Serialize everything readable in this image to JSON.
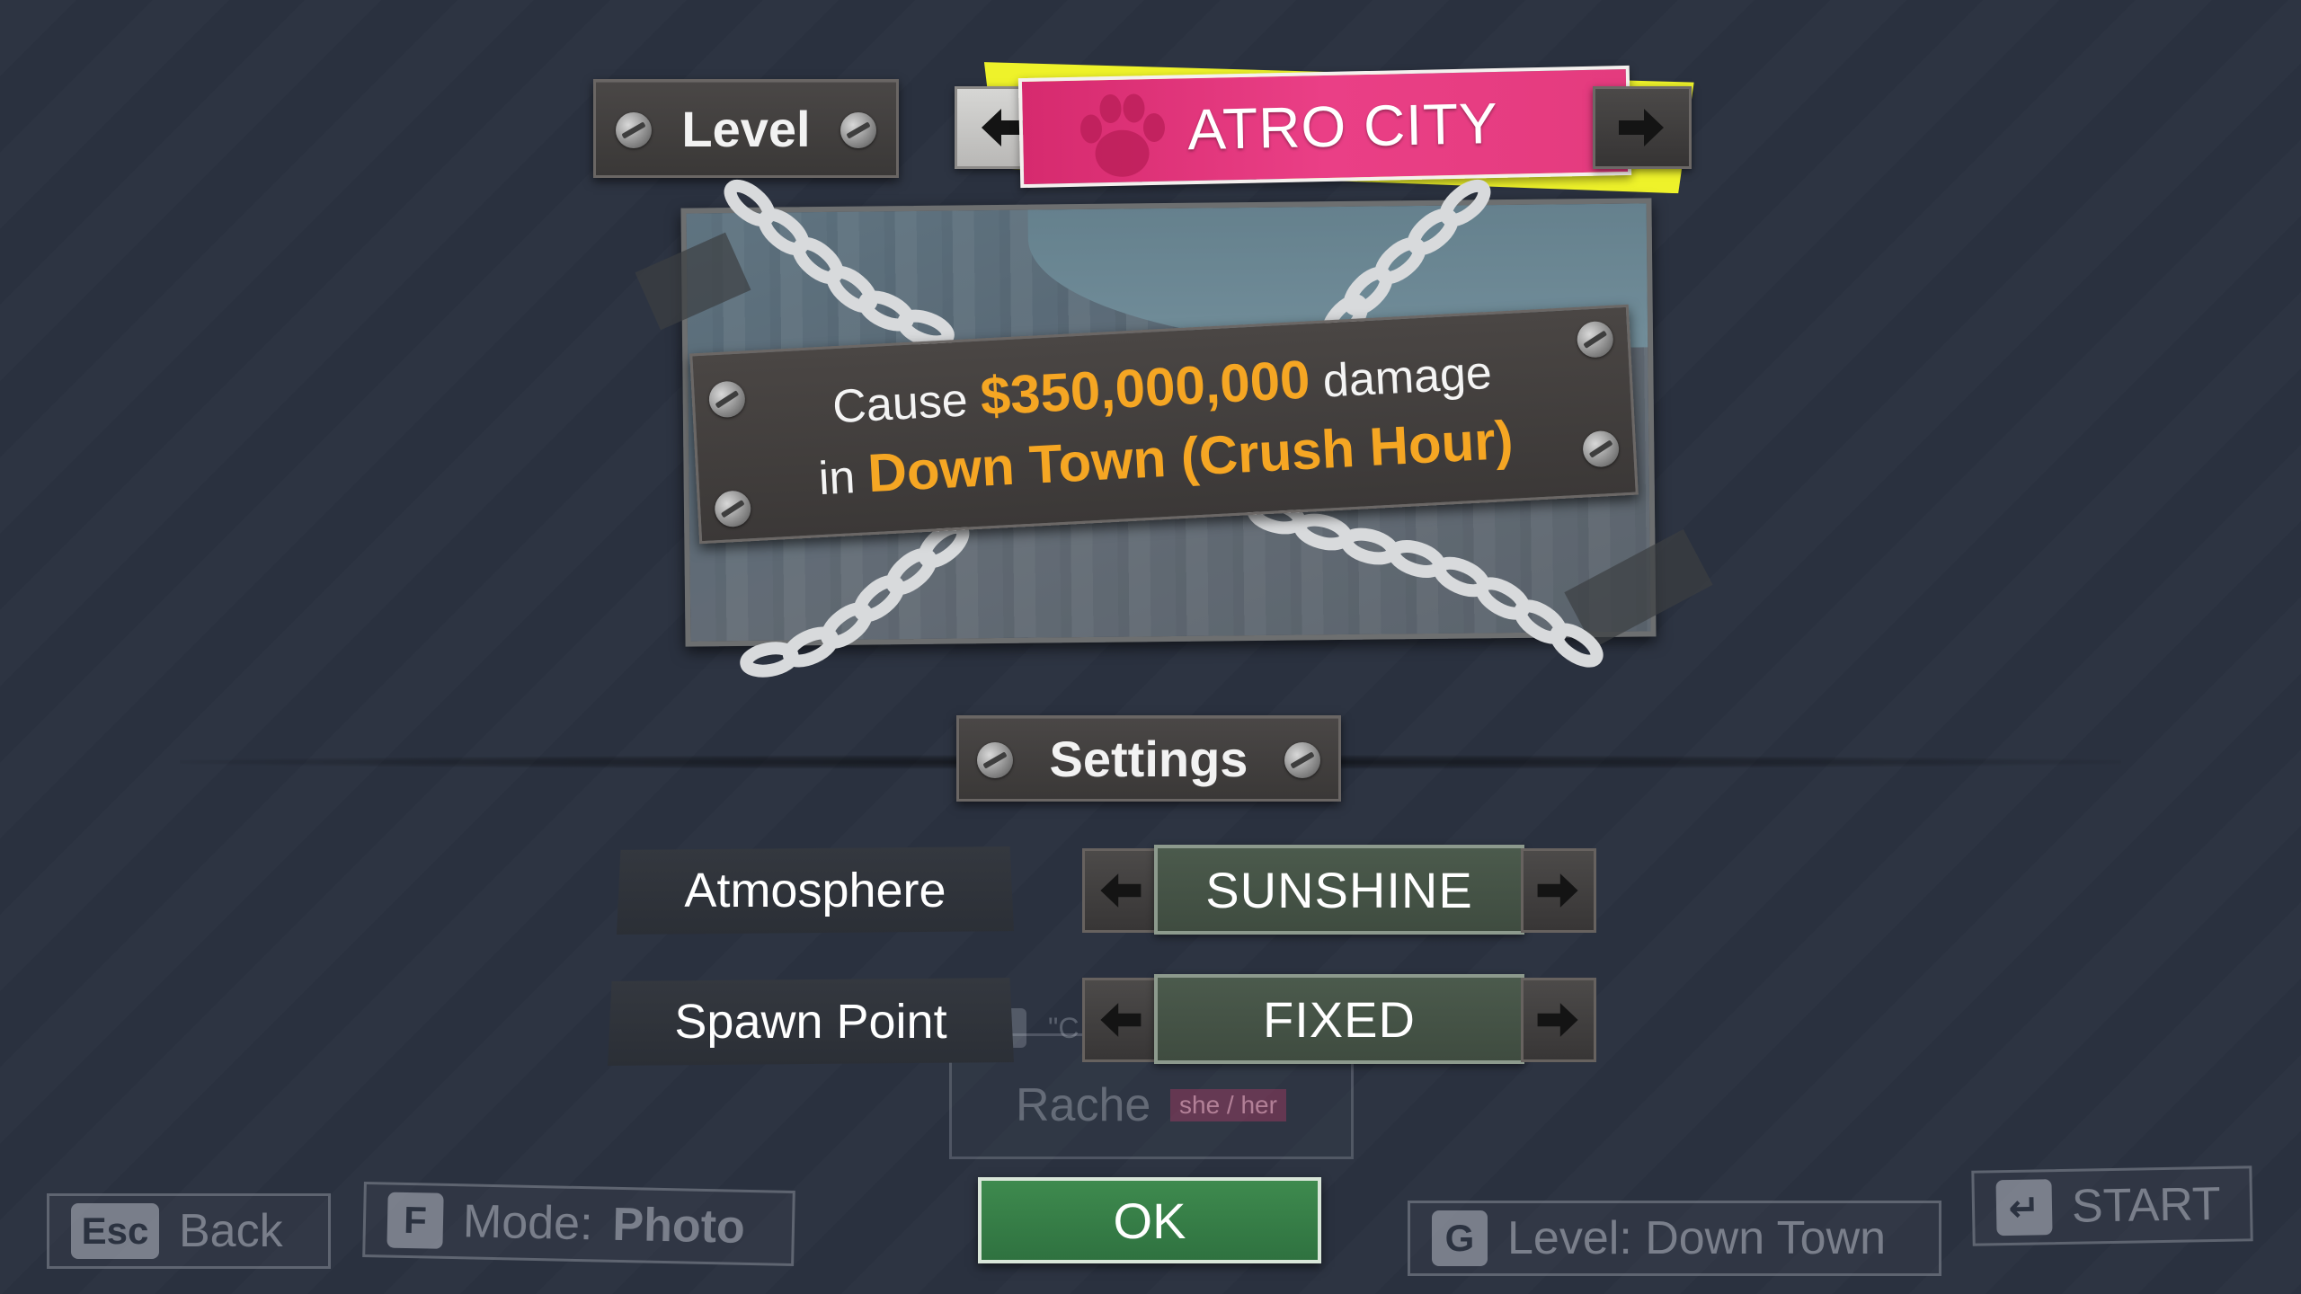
{
  "level": {
    "header_label": "Level",
    "name": "ATRO CITY",
    "prev_arrow": "arrow-left-icon",
    "next_arrow": "arrow-right-icon"
  },
  "objective": {
    "line1_prefix": "Cause",
    "amount": "$350,000,000",
    "line1_suffix": "damage",
    "line2_prefix": "in",
    "location": "Down Town (Crush Hour)"
  },
  "settings": {
    "header_label": "Settings",
    "rows": [
      {
        "label": "Atmosphere",
        "value": "SUNSHINE"
      },
      {
        "label": "Spawn Point",
        "value": "FIXED"
      }
    ]
  },
  "ok_label": "OK",
  "background_controls": {
    "back": {
      "key": "Esc",
      "label": "Back"
    },
    "mode": {
      "key": "F",
      "label": "Mode:",
      "value": "Photo"
    },
    "level": {
      "key": "G",
      "label": "Level: Down Town"
    },
    "start": {
      "label": "START"
    },
    "player_card": {
      "name": "Rache",
      "pronouns": "she / her",
      "quote": "\"C"
    }
  },
  "colors": {
    "background": "#2b3240",
    "accent_pink": "#e63a80",
    "accent_yellow": "#eef22a",
    "highlight_orange": "#f5a623",
    "ok_green": "#357c46",
    "option_green": "#46544a"
  }
}
